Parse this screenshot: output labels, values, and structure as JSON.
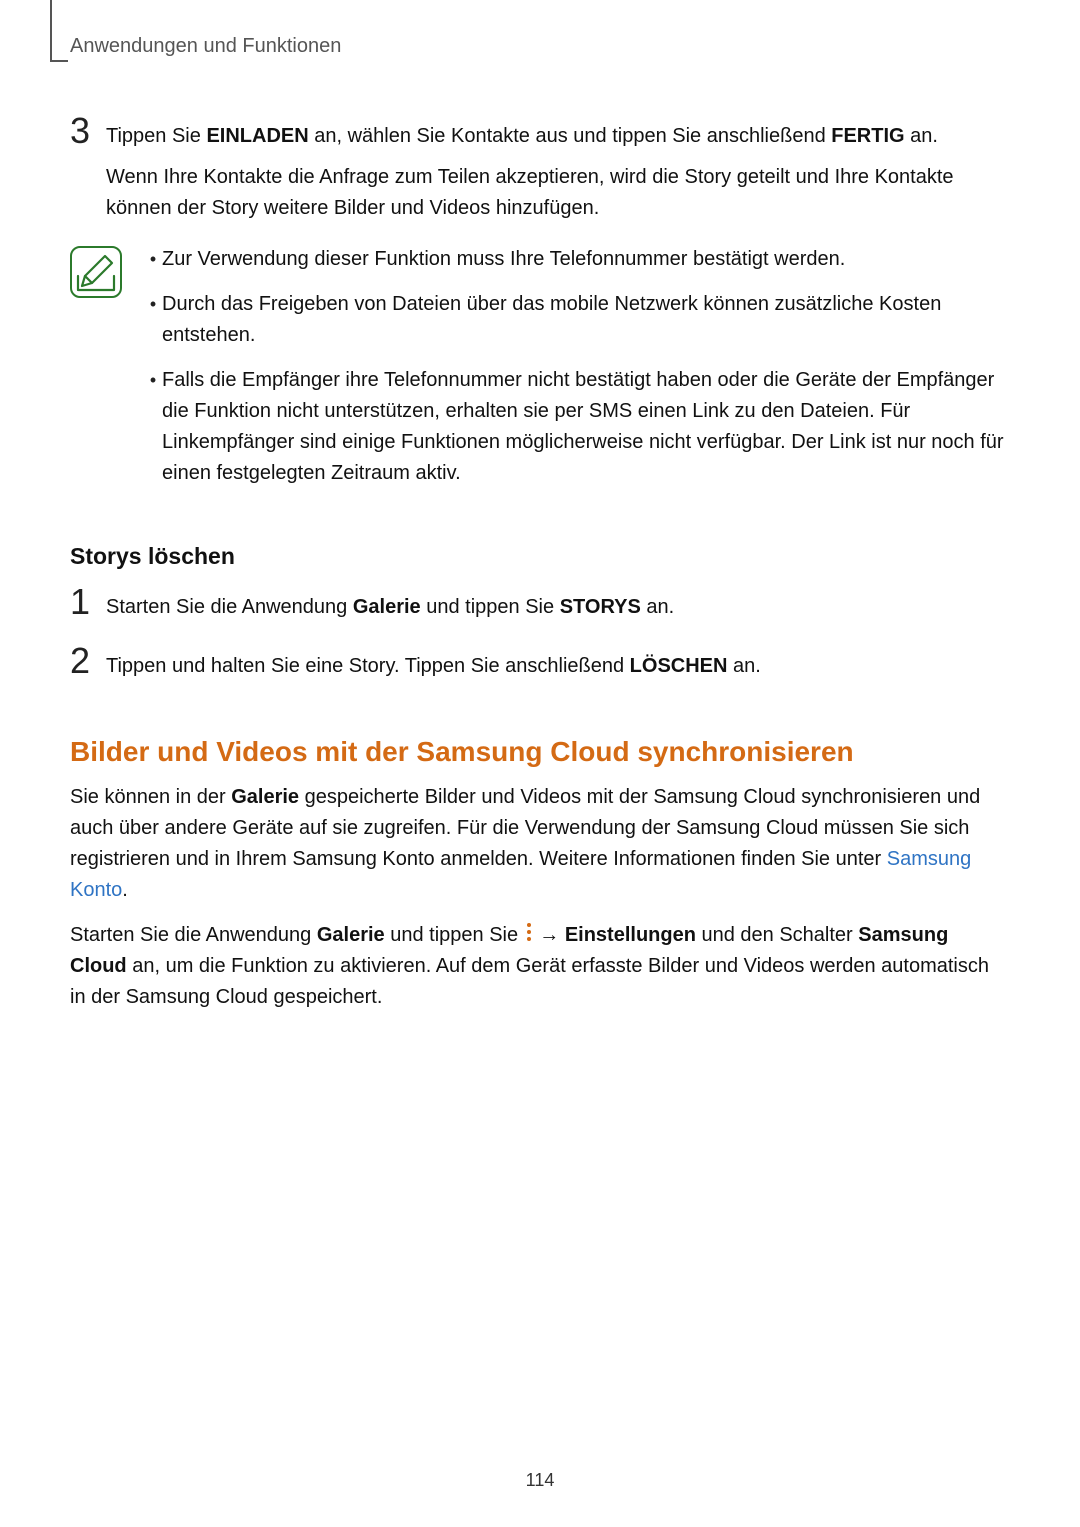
{
  "header": {
    "running_head": "Anwendungen und Funktionen"
  },
  "step3": {
    "num": "3",
    "line1_pre": "Tippen Sie ",
    "line1_b1": "EINLADEN",
    "line1_mid": " an, wählen Sie Kontakte aus und tippen Sie anschließend ",
    "line1_b2": "FERTIG",
    "line1_post": " an.",
    "para2": "Wenn Ihre Kontakte die Anfrage zum Teilen akzeptieren, wird die Story geteilt und Ihre Kontakte können der Story weitere Bilder und Videos hinzufügen."
  },
  "note": {
    "item1": "Zur Verwendung dieser Funktion muss Ihre Telefonnummer bestätigt werden.",
    "item2": "Durch das Freigeben von Dateien über das mobile Netzwerk können zusätzliche Kosten entstehen.",
    "item3": "Falls die Empfänger ihre Telefonnummer nicht bestätigt haben oder die Geräte der Empfänger die Funktion nicht unterstützen, erhalten sie per SMS einen Link zu den Dateien. Für Linkempfänger sind einige Funktionen möglicherweise nicht verfügbar. Der Link ist nur noch für einen festgelegten Zeitraum aktiv."
  },
  "delete_section": {
    "heading": "Storys löschen",
    "step1_num": "1",
    "step1_pre": "Starten Sie die Anwendung ",
    "step1_b1": "Galerie",
    "step1_mid": " und tippen Sie ",
    "step1_b2": "STORYS",
    "step1_post": " an.",
    "step2_num": "2",
    "step2_pre": "Tippen und halten Sie eine Story. Tippen Sie anschließend ",
    "step2_b1": "LÖSCHEN",
    "step2_post": " an."
  },
  "sync_section": {
    "heading": "Bilder und Videos mit der Samsung Cloud synchronisieren",
    "p1_pre": "Sie können in der ",
    "p1_b1": "Galerie",
    "p1_mid": " gespeicherte Bilder und Videos mit der Samsung Cloud synchronisieren und auch über andere Geräte auf sie zugreifen. Für die Verwendung der Samsung Cloud müssen Sie sich registrieren und in Ihrem Samsung Konto anmelden. Weitere Informationen finden Sie unter ",
    "p1_link": "Samsung Konto",
    "p1_post": ".",
    "p2_pre": "Starten Sie die Anwendung ",
    "p2_b1": "Galerie",
    "p2_mid1": " und tippen Sie ",
    "p2_arrow": " → ",
    "p2_b2": "Einstellungen",
    "p2_mid2": " und den Schalter ",
    "p2_b3": "Samsung Cloud",
    "p2_post": " an, um die Funktion zu aktivieren. Auf dem Gerät erfasste Bilder und Videos werden automatisch in der Samsung Cloud gespeichert."
  },
  "page_number": "114"
}
